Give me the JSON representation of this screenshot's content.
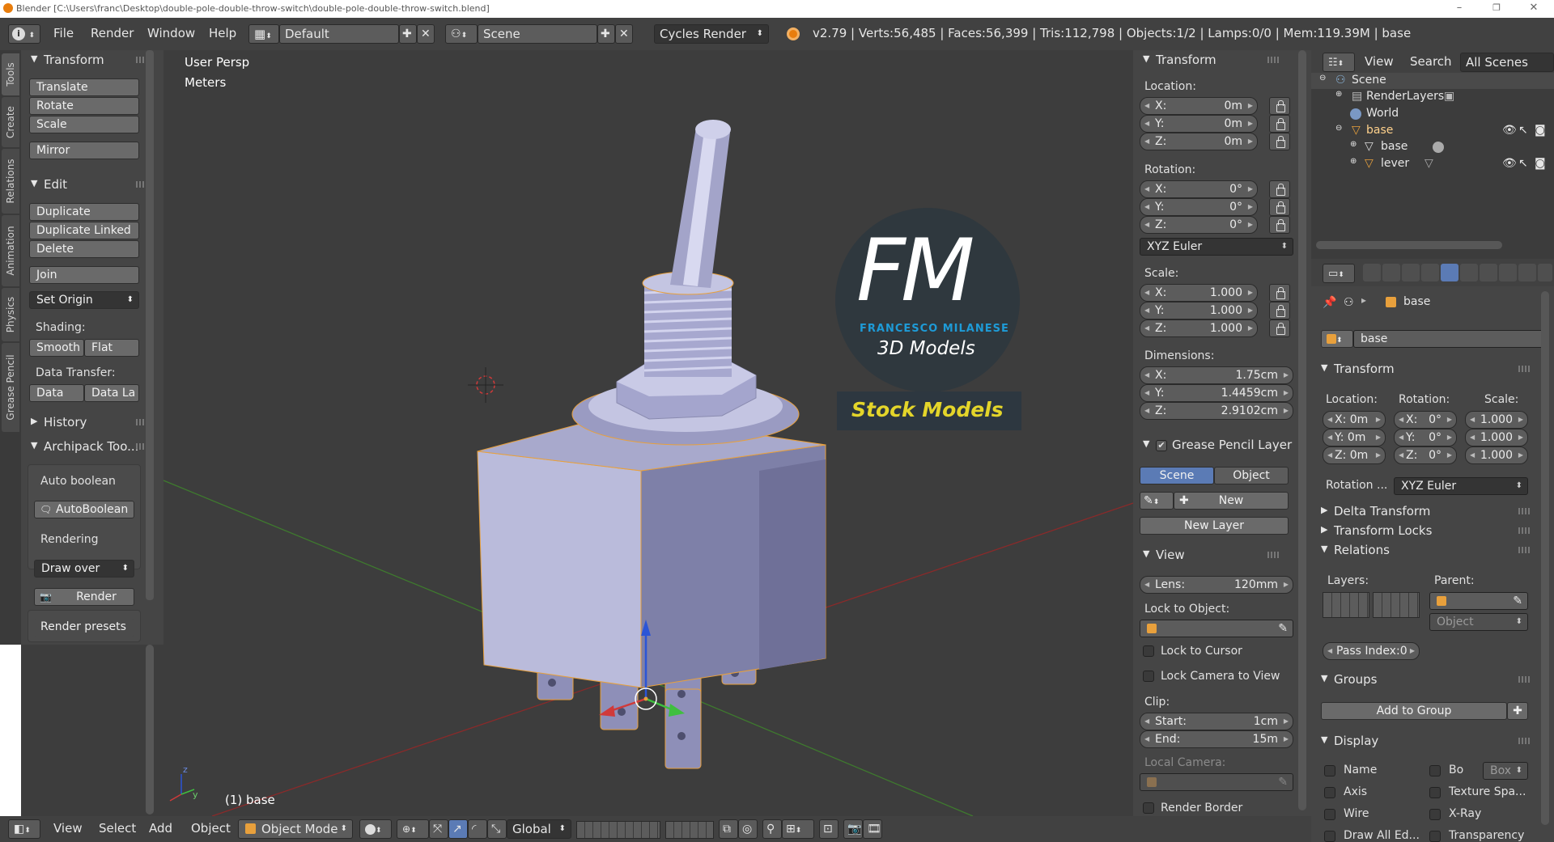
{
  "window": {
    "title": "Blender [C:\\Users\\franc\\Desktop\\double-pole-double-throw-switch\\double-pole-double-throw-switch.blend]",
    "controls": [
      "–",
      "❐",
      "✕"
    ]
  },
  "info_header": {
    "menus": [
      "File",
      "Render",
      "Window",
      "Help"
    ],
    "screen_layout": "Default",
    "scene": "Scene",
    "render_engine": "Cycles Render",
    "stats": "v2.79 | Verts:56,485 | Faces:56,399 | Tris:112,798 | Objects:1/2 | Lamps:0/0 | Mem:119.39M | base"
  },
  "tool_tabs": [
    "Tools",
    "Create",
    "Relations",
    "Animation",
    "Physics",
    "Grease Pencil"
  ],
  "tool_shelf": {
    "transform": {
      "title": "Transform",
      "buttons": [
        "Translate",
        "Rotate",
        "Scale",
        "Mirror"
      ]
    },
    "edit": {
      "title": "Edit",
      "buttons": [
        "Duplicate",
        "Duplicate Linked",
        "Delete",
        "Join"
      ],
      "set_origin": "Set Origin",
      "shading_label": "Shading:",
      "smooth": "Smooth",
      "flat": "Flat",
      "data_transfer_label": "Data Transfer:",
      "data": "Data",
      "data_layers": "Data La"
    },
    "history": "History",
    "archipack": {
      "title": "Archipack Too...",
      "auto_boolean_label": "Auto boolean",
      "auto_boolean_btn": "AutoBoolean",
      "rendering_label": "Rendering",
      "draw_over": "Draw over",
      "render": "Render",
      "render_presets": "Render presets ..."
    }
  },
  "viewport": {
    "view_name": "User Persp",
    "units": "Meters",
    "object_label": "(1) base",
    "logo": {
      "initials": "FM",
      "name": "FRANCESCO MILANESE",
      "subtitle": "3D Models",
      "banner": "Stock Models"
    },
    "colors": {
      "background": "#3d3d3d",
      "x_axis": "#8a2a2a",
      "y_axis": "#3e7a2e",
      "selection": "#e8a03c",
      "logo_blue": "#1e9bd7",
      "banner_text": "#e4d52a"
    }
  },
  "viewport_header": {
    "menus": [
      "View",
      "Select",
      "Add",
      "Object"
    ],
    "mode": "Object Mode",
    "orientation": "Global"
  },
  "n_panel": {
    "transform_title": "Transform",
    "location_label": "Location:",
    "location": [
      [
        "X:",
        "0m"
      ],
      [
        "Y:",
        "0m"
      ],
      [
        "Z:",
        "0m"
      ]
    ],
    "rotation_label": "Rotation:",
    "rotation": [
      [
        "X:",
        "0°"
      ],
      [
        "Y:",
        "0°"
      ],
      [
        "Z:",
        "0°"
      ]
    ],
    "rotation_mode": "XYZ Euler",
    "scale_label": "Scale:",
    "scale": [
      [
        "X:",
        "1.000"
      ],
      [
        "Y:",
        "1.000"
      ],
      [
        "Z:",
        "1.000"
      ]
    ],
    "dimensions_label": "Dimensions:",
    "dimensions": [
      [
        "X:",
        "1.75cm"
      ],
      [
        "Y:",
        "1.4459cm"
      ],
      [
        "Z:",
        "2.9102cm"
      ]
    ],
    "grease_pencil_title": "Grease Pencil Layer",
    "gp_scene": "Scene",
    "gp_object": "Object",
    "gp_new": "New",
    "gp_new_layer": "New Layer",
    "view_title": "View",
    "lens_key": "Lens:",
    "lens_val": "120mm",
    "lock_to_object": "Lock to Object:",
    "lock_to_cursor": "Lock to Cursor",
    "lock_camera": "Lock Camera to View",
    "clip_label": "Clip:",
    "clip_start_key": "Start:",
    "clip_start_val": "1cm",
    "clip_end_key": "End:",
    "clip_end_val": "15m",
    "local_camera": "Local Camera:",
    "render_border": "Render Border"
  },
  "outliner": {
    "menus": [
      "View",
      "Search"
    ],
    "filter": "All Scenes",
    "items": [
      "Scene",
      "RenderLayers",
      "World",
      "base",
      "base",
      "lever"
    ]
  },
  "properties": {
    "object_name_crumb": "base",
    "object_name": "base",
    "transform_title": "Transform",
    "location_label": "Location:",
    "rotation_label": "Rotation:",
    "scale_label": "Scale:",
    "loc": [
      "X: 0m",
      "Y: 0m",
      "Z: 0m"
    ],
    "rot": [
      [
        "X:",
        "0°"
      ],
      [
        "Y:",
        "0°"
      ],
      [
        "Z:",
        "0°"
      ]
    ],
    "scl": [
      "1.000",
      "1.000",
      "1.000"
    ],
    "rotation_mode_label": "Rotation ...",
    "rotation_mode": "XYZ Euler",
    "delta_transform": "Delta Transform",
    "transform_locks": "Transform Locks",
    "relations": "Relations",
    "layers_label": "Layers:",
    "parent_label": "Parent:",
    "parent_type": "Object",
    "pass_index": "Pass Index:0",
    "groups": "Groups",
    "add_to_group": "Add to Group",
    "display": "Display",
    "display_left": [
      "Name",
      "Axis",
      "Wire",
      "Draw All Ed..."
    ],
    "display_right": [
      "Bo",
      "Texture Spa...",
      "X-Ray",
      "Transparency"
    ],
    "bounds_type": "Box"
  }
}
